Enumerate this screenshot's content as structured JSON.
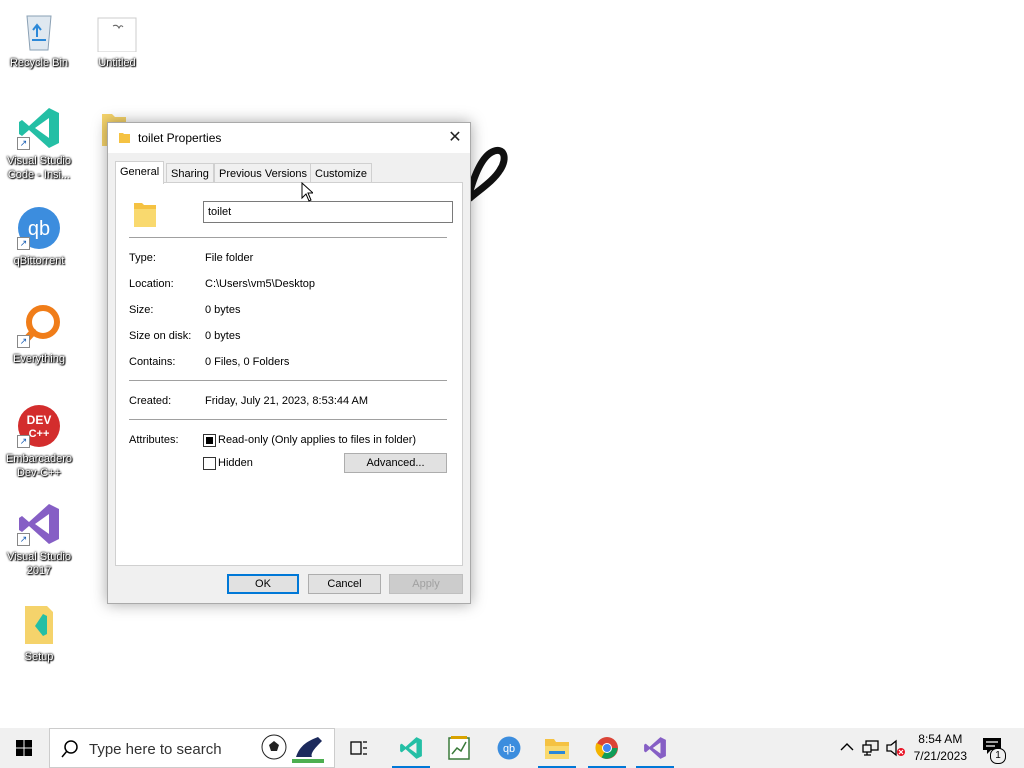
{
  "desktop": {
    "icons": [
      {
        "label": "Recycle Bin"
      },
      {
        "label": "Untitled"
      },
      {
        "label": "Visual Studio Code - Insi..."
      },
      {
        "label": "qBittorrent"
      },
      {
        "label": "Everything"
      },
      {
        "label": "Embarcadero Dev-C++"
      },
      {
        "label": "Visual Studio 2017"
      },
      {
        "label": "Setup"
      }
    ]
  },
  "dialog": {
    "title": "toilet Properties",
    "tabs": [
      "General",
      "Sharing",
      "Previous Versions",
      "Customize"
    ],
    "active_tab": "General",
    "name_value": "toilet",
    "fields": [
      {
        "label": "Type:",
        "value": "File folder"
      },
      {
        "label": "Location:",
        "value": "C:\\Users\\vm5\\Desktop"
      },
      {
        "label": "Size:",
        "value": "0 bytes"
      },
      {
        "label": "Size on disk:",
        "value": "0 bytes"
      },
      {
        "label": "Contains:",
        "value": "0 Files, 0 Folders"
      }
    ],
    "created": {
      "label": "Created:",
      "value": "Friday, July 21, 2023, 8:53:44 AM"
    },
    "attributes": {
      "label": "Attributes:",
      "readonly": {
        "label": "Read-only (Only applies to files in folder)",
        "state": "indeterminate"
      },
      "hidden": {
        "label": "Hidden",
        "checked": false
      },
      "advanced_label": "Advanced..."
    },
    "buttons": {
      "ok": "OK",
      "cancel": "Cancel",
      "apply": "Apply"
    }
  },
  "taskbar": {
    "search_placeholder": "Type here to search",
    "time": "8:54 AM",
    "date": "7/21/2023",
    "notification_count": "1"
  }
}
